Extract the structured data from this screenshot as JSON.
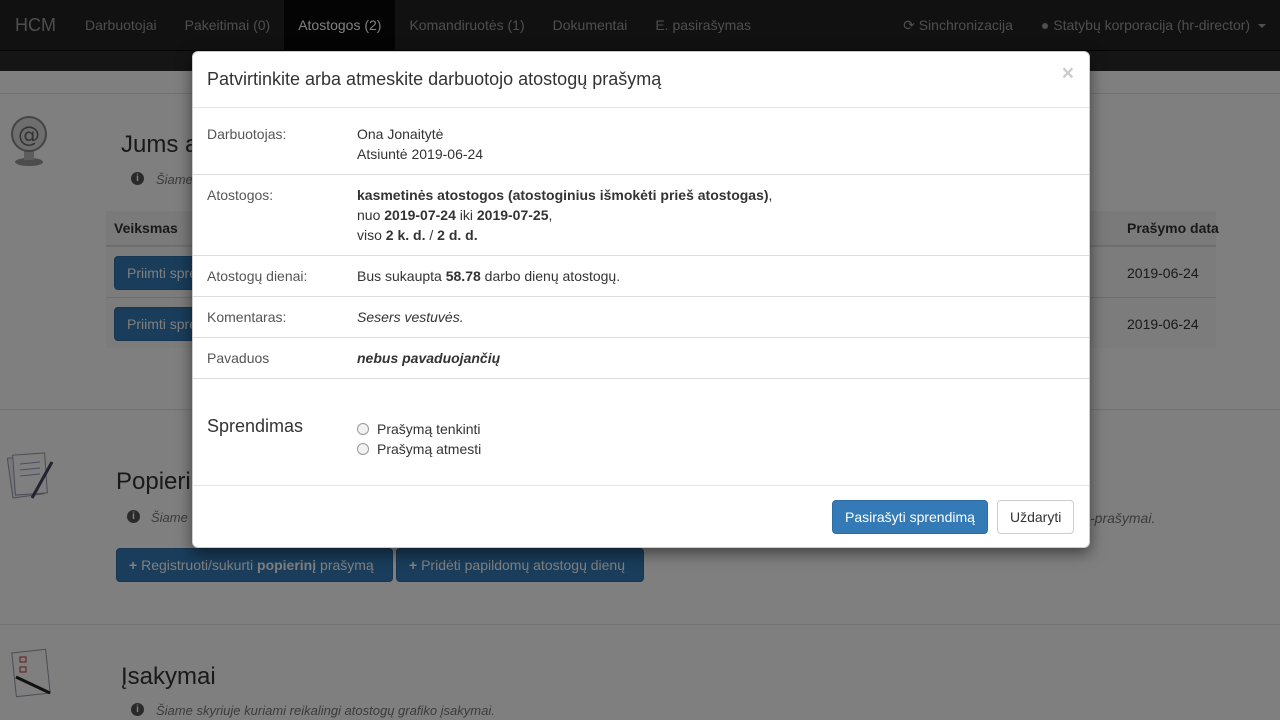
{
  "navbar": {
    "brand": "HCM",
    "items": [
      {
        "label": "Darbuotojai"
      },
      {
        "label": "Pakeitimai (0)"
      },
      {
        "label": "Atostogos (2)"
      },
      {
        "label": "Komandiruotės (1)"
      },
      {
        "label": "Dokumentai"
      },
      {
        "label": "E. pasirašymas"
      }
    ],
    "sync_label": "Sinchronizacija",
    "user_label": "Statybų korporacija (hr-director)"
  },
  "background": {
    "section1": {
      "title": "Jums a",
      "info": "Šiame",
      "table_header_action": "Veiksmas",
      "table_header_date": "Prašymo data",
      "rows": [
        {
          "button": "Priimti spre",
          "date": "2019-06-24"
        },
        {
          "button": "Priimti spre",
          "date": "2019-06-24"
        }
      ]
    },
    "section2": {
      "title": "Popieri",
      "info": "Šiame",
      "info_tail": "-prašymai.",
      "btn_register_pre": "Registruoti/sukurti ",
      "btn_register_bold": "popierinį",
      "btn_register_post": " prašymą",
      "btn_add_days": "Pridėti papildomų atostogų dienų"
    },
    "section3": {
      "title": "Įsakymai",
      "info": "Šiame skyriuje kuriami reikalingi atostogų grafiko įsakymai."
    }
  },
  "modal": {
    "title": "Patvirtinkite arba atmeskite darbuotojo atostogų prašymą",
    "close": "×",
    "employee_label": "Darbuotojas:",
    "employee_name": "Ona Jonaitytė",
    "employee_sent": "Atsiuntė 2019-06-24",
    "vacation_label": "Atostogos:",
    "vacation_type": "kasmetinės atostogos (atostoginius išmokėti prieš atostogas)",
    "vacation_type_suffix": ",",
    "from_word": "nuo ",
    "from_date": "2019-07-24",
    "to_word": " iki ",
    "to_date": "2019-07-25",
    "to_suffix": ",",
    "total_word": "viso ",
    "total_kd": "2 k. d.",
    "total_sep": " / ",
    "total_dd": "2 d. d.",
    "days_label": "Atostogų dienai:",
    "days_pre": "Bus sukaupta ",
    "days_value": "58.78",
    "days_post": " darbo dienų atostogų.",
    "comment_label": "Komentaras:",
    "comment_value": "Sesers vestuvės.",
    "substitute_label": "Pavaduos",
    "substitute_value": "nebus pavaduojančių",
    "decision_title": "Sprendimas",
    "option_approve": "Prašymą tenkinti",
    "option_reject": "Prašymą atmesti",
    "sign_button": "Pasirašyti sprendimą",
    "close_button": "Uždaryti"
  },
  "colors": {
    "navbar_bg": "#222222",
    "primary": "#337ab7"
  }
}
